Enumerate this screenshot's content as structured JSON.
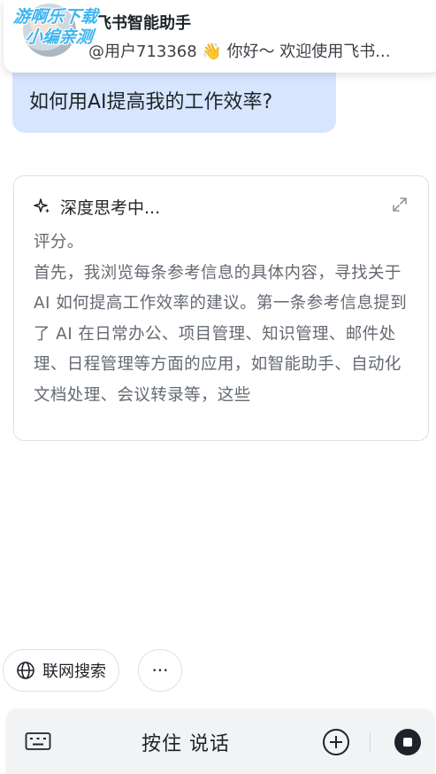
{
  "banner": {
    "title": "飞书智能助手",
    "message": "@用户713368 👋 你好～ 欢迎使用飞书..."
  },
  "watermark": {
    "line1": "游啊乐下载",
    "line2": "小编亲测"
  },
  "conversation": {
    "user_message": "如何用AI提高我的工作效率?"
  },
  "thinking": {
    "title": "深度思考中...",
    "paragraphs": [
      "评分。",
      "首先，我浏览每条参考信息的具体内容，寻找关于 AI 如何提高工作效率的建议。第一条参考信息提到了 AI 在日常办公、项目管理、知识管理、邮件处理、日程管理等方面的应用，如智能助手、自动化文档处理、会议转录等，这些"
    ]
  },
  "chips": {
    "web_search": "联网搜索",
    "more": "···"
  },
  "input_bar": {
    "hold_to_talk": "按住 说话"
  },
  "icons": [
    "keyboard-icon",
    "globe-icon",
    "sparkle-icon",
    "expand-icon",
    "plus-circle-icon",
    "stop-icon"
  ]
}
